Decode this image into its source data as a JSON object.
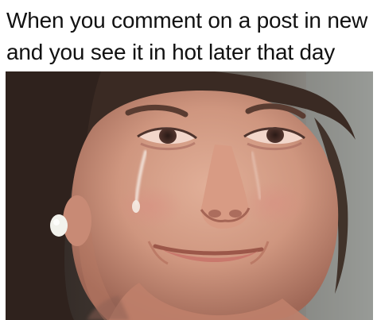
{
  "caption": {
    "line1": "When you comment on a post in new",
    "line2": "and you see it in hot later that day"
  },
  "photo": {
    "subject": "tearful smiling woman close-up portrait",
    "dominant_colors": {
      "hair": "#3b2a22",
      "skin": "#d7a28c",
      "background": "#6d6b6a",
      "earring": "#f2f2ec"
    }
  }
}
